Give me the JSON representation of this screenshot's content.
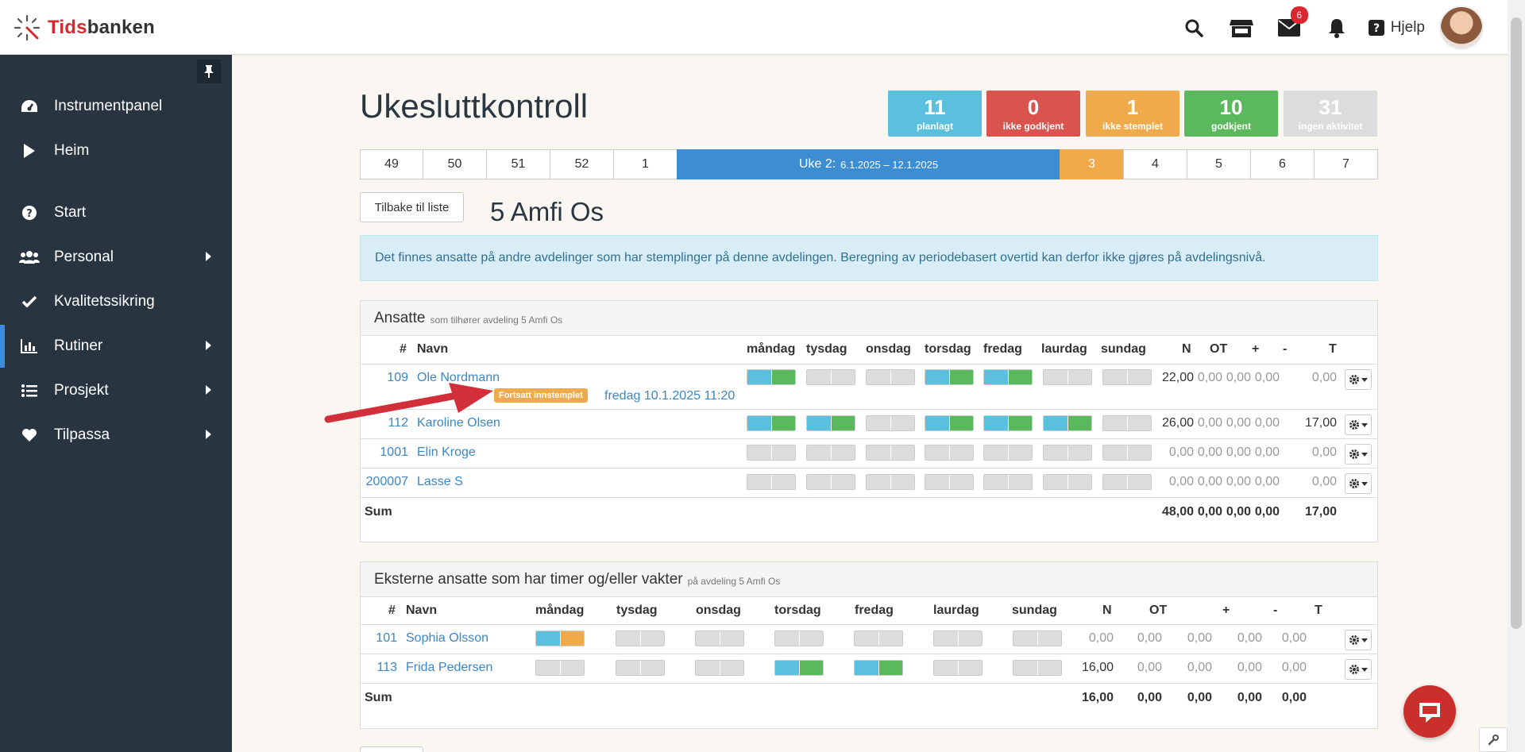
{
  "app": {
    "brand_a": "Tids",
    "brand_b": "banken"
  },
  "topbar": {
    "mail_badge": "6",
    "help_label": "Hjelp"
  },
  "sidebar": {
    "items": [
      {
        "label": "Instrumentpanel",
        "icon": "dashboard-icon"
      },
      {
        "label": "Heim",
        "icon": "play-icon"
      },
      {
        "label": "Start",
        "icon": "question-icon"
      },
      {
        "label": "Personal",
        "icon": "users-icon"
      },
      {
        "label": "Kvalitetssikring",
        "icon": "check-icon"
      },
      {
        "label": "Rutiner",
        "icon": "chart-icon"
      },
      {
        "label": "Prosjekt",
        "icon": "list-icon"
      },
      {
        "label": "Tilpassa",
        "icon": "heart-icon"
      }
    ]
  },
  "page": {
    "title": "Ukesluttkontroll",
    "back_label": "Tilbake til liste",
    "dept": "5 Amfi Os"
  },
  "stats": [
    {
      "n": "11",
      "label": "planlagt",
      "color": "#5bc0de"
    },
    {
      "n": "0",
      "label": "ikke godkjent",
      "color": "#d9534f"
    },
    {
      "n": "1",
      "label": "ikke stemplet",
      "color": "#efaa4b"
    },
    {
      "n": "10",
      "label": "godkjent",
      "color": "#5cb85c"
    },
    {
      "n": "31",
      "label": "ingen aktivitet",
      "color": "#dcdcdc"
    }
  ],
  "weeks": [
    "49",
    "50",
    "51",
    "52",
    "1",
    "Uke 2:",
    "3",
    "4",
    "5",
    "6",
    "7"
  ],
  "current_week_range": "6.1.2025 – 12.1.2025",
  "alert": "Det finnes ansatte på andre avdelinger som har stemplinger på denne avdelingen. Beregning av periodebasert overtid kan derfor ikke gjøres på avdelingsnivå.",
  "panel1": {
    "title": "Ansatte",
    "sub": "som tilhører avdeling 5 Amfi Os",
    "headers": [
      "#",
      "Navn",
      "måndag",
      "tysdag",
      "onsdag",
      "torsdag",
      "fredag",
      "laurdag",
      "sundag",
      "N",
      "OT",
      "+",
      "-",
      "T"
    ],
    "rows": [
      {
        "id": "109",
        "name": "Ole Nordmann",
        "days": [
          "bg",
          "g",
          "g",
          "bg",
          "bg",
          "g",
          "g"
        ],
        "N": "22,00",
        "OT": "0,00",
        "plus": "0,00",
        "minus": "0,00",
        "T": "0,00",
        "tag": "Fortsatt innstemplet",
        "tag_date": "fredag 10.1.2025 11:20"
      },
      {
        "id": "112",
        "name": "Karoline Olsen",
        "days": [
          "bg",
          "bg",
          "g",
          "bg",
          "bg",
          "bg",
          "g"
        ],
        "N": "26,00",
        "OT": "0,00",
        "plus": "0,00",
        "minus": "0,00",
        "T": "17,00"
      },
      {
        "id": "1001",
        "name": "Elin Kroge",
        "days": [
          "g",
          "g",
          "g",
          "g",
          "g",
          "g",
          "g"
        ],
        "N": "0,00",
        "OT": "0,00",
        "plus": "0,00",
        "minus": "0,00",
        "T": "0,00"
      },
      {
        "id": "200007",
        "name": "Lasse S",
        "days": [
          "g",
          "g",
          "g",
          "g",
          "g",
          "g",
          "g"
        ],
        "N": "0,00",
        "OT": "0,00",
        "plus": "0,00",
        "minus": "0,00",
        "T": "0,00"
      }
    ],
    "sum": {
      "label": "Sum",
      "N": "48,00",
      "OT": "0,00",
      "plus": "0,00",
      "minus": "0,00",
      "T": "17,00"
    }
  },
  "panel2": {
    "title": "Eksterne ansatte som har timer og/eller vakter",
    "sub": "på avdeling 5 Amfi Os",
    "headers": [
      "#",
      "Navn",
      "måndag",
      "tysdag",
      "onsdag",
      "torsdag",
      "fredag",
      "laurdag",
      "sundag",
      "N",
      "OT",
      "+",
      "-",
      "T"
    ],
    "rows": [
      {
        "id": "101",
        "name": "Sophia Olsson",
        "days": [
          "bo",
          "g",
          "g",
          "g",
          "g",
          "g",
          "g"
        ],
        "N": "0,00",
        "OT": "0,00",
        "plus": "0,00",
        "minus": "0,00",
        "T": "0,00"
      },
      {
        "id": "113",
        "name": "Frida Pedersen",
        "days": [
          "g",
          "g",
          "g",
          "bg",
          "bg",
          "g",
          "g"
        ],
        "N": "16,00",
        "OT": "0,00",
        "plus": "0,00",
        "minus": "0,00",
        "T": "0,00"
      }
    ],
    "sum": {
      "label": "Sum",
      "N": "16,00",
      "OT": "0,00",
      "plus": "0,00",
      "minus": "0,00",
      "T": "0,00"
    }
  }
}
